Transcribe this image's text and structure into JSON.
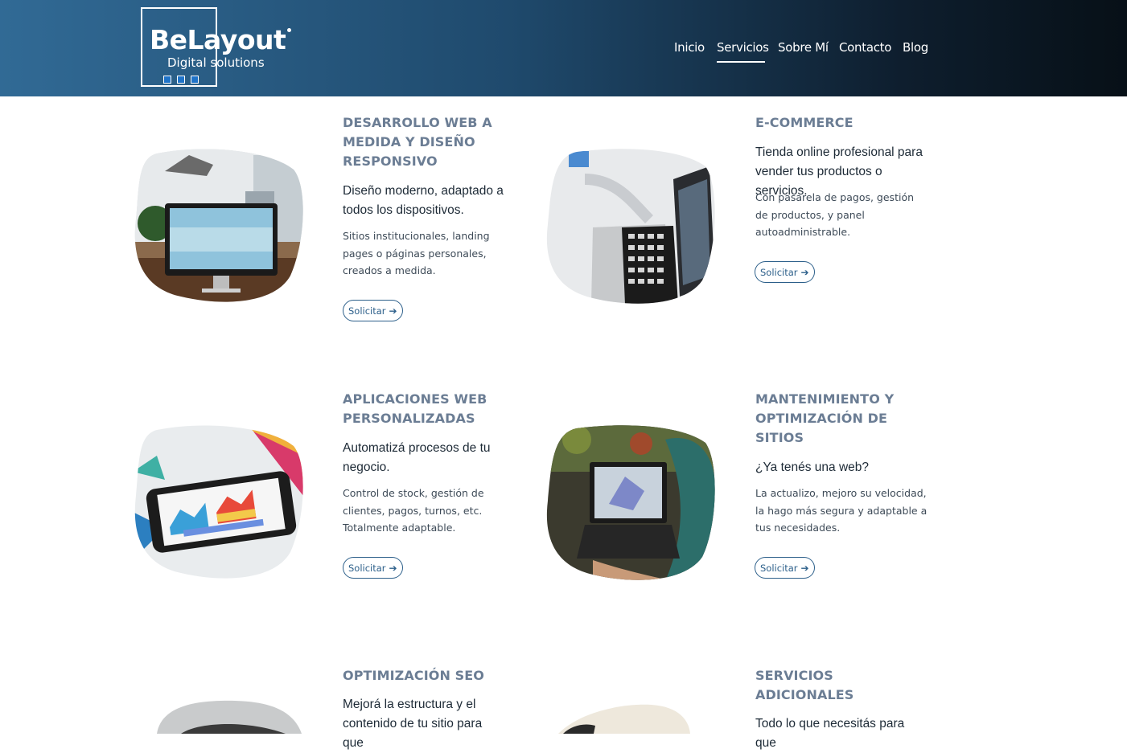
{
  "brand": {
    "name": "BeLayout",
    "tagline": "Digital solutions"
  },
  "nav": {
    "items": [
      {
        "label": "Inicio"
      },
      {
        "label": "Servicios",
        "active": true
      },
      {
        "label": "Sobre Mí"
      },
      {
        "label": "Contacto"
      },
      {
        "label": "Blog"
      }
    ]
  },
  "services": [
    {
      "title": "DESARROLLO WEB A MEDIDA Y DISEÑO RESPONSIVO",
      "lead": "Diseño moderno, adaptado a todos los dispositivos.",
      "description": "Sitios institucionales, landing pages o páginas personales, creados a medida.",
      "button": "Solicitar"
    },
    {
      "title": "E-COMMERCE",
      "lead": "Tienda online profesional para vender tus productos o servicios.",
      "description": "Con pasarela de pagos, gestión de productos, y panel autoadministrable.",
      "button": "Solicitar"
    },
    {
      "title": "APLICACIONES WEB PERSONALIZADAS",
      "lead": "Automatizá procesos de tu negocio.",
      "description": "Control de stock, gestión de clientes, pagos, turnos, etc. Totalmente adaptable.",
      "button": "Solicitar"
    },
    {
      "title": "MANTENIMIENTO Y OPTIMIZACIÓN DE SITIOS",
      "lead": "¿Ya tenés una web?",
      "description": "La actualizo, mejoro su velocidad, la hago más segura y adaptable a tus necesidades.",
      "button": "Solicitar"
    },
    {
      "title": "OPTIMIZACIÓN SEO",
      "lead": "Mejorá la estructura y el contenido de tu sitio para que"
    },
    {
      "title": "SERVICIOS ADICIONALES",
      "lead": "Todo lo que necesitás para que"
    }
  ],
  "colors": {
    "header_start": "#316a95",
    "header_end": "#071017",
    "title": "#6b7d94",
    "button": "#2c5f8a"
  },
  "icons": {
    "button_arrow": "arrow-right-icon"
  }
}
